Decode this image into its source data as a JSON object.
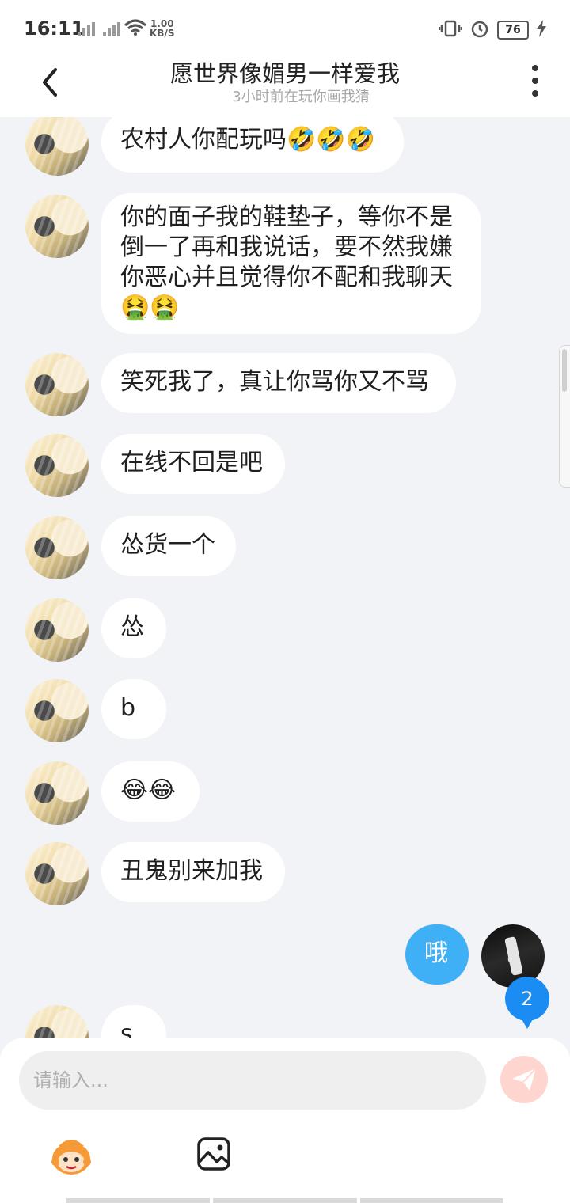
{
  "status_bar": {
    "time": "16:11",
    "net_speed_value": "1.00",
    "net_speed_unit": "KB/S",
    "battery": "76"
  },
  "header": {
    "title": "愿世界像媚男一样爱我",
    "subtitle": "3小时前在玩你画我猜"
  },
  "messages": [
    {
      "sender": "other",
      "text": "农村人你配玩吗🤣🤣🤣"
    },
    {
      "sender": "other",
      "line1": "你的面子我的鞋垫子，等你不是",
      "line2": "倒一了再和我说话，要不然我嫌",
      "line3": "你恶心并且觉得你不配和我聊天",
      "line4": "🤮🤮"
    },
    {
      "sender": "other",
      "text": "笑死我了，真让你骂你又不骂"
    },
    {
      "sender": "other",
      "text": "在线不回是吧"
    },
    {
      "sender": "other",
      "text": "怂货一个"
    },
    {
      "sender": "other",
      "text": "怂"
    },
    {
      "sender": "other",
      "text": "b"
    },
    {
      "sender": "other",
      "text": "😂😂"
    },
    {
      "sender": "other",
      "text": "丑鬼别来加我"
    },
    {
      "sender": "me",
      "text": "哦"
    },
    {
      "sender": "other",
      "text": "s"
    }
  ],
  "unread_count": "2",
  "composer": {
    "placeholder": "请输入..."
  },
  "colors": {
    "my_bubble": "#3fb0f5",
    "other_bubble": "#ffffff",
    "background": "#f2f3f6",
    "send_button": "#ffd6cf",
    "badge": "#1a8cf2"
  },
  "icons": [
    "back-icon",
    "more-icon",
    "send-icon",
    "sticker-face-icon",
    "image-icon",
    "wifi-icon",
    "signal-icon",
    "vibrate-icon",
    "alarm-icon",
    "battery-icon",
    "charging-icon"
  ]
}
